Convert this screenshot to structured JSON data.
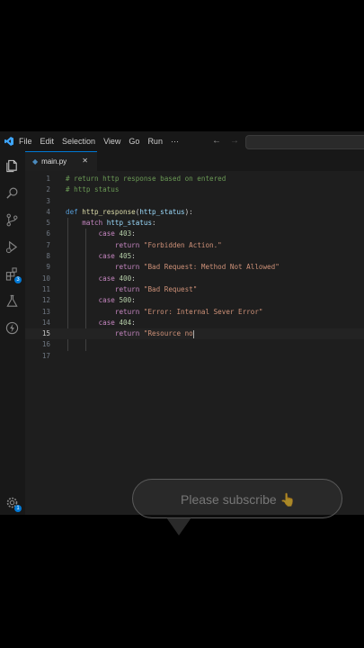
{
  "titlebar": {
    "menu": [
      "File",
      "Edit",
      "Selection",
      "View",
      "Go",
      "Run"
    ],
    "more": "···",
    "back_icon": "arrow-left-icon",
    "forward_icon": "arrow-right-icon"
  },
  "activitybar": {
    "icons": [
      "explorer-icon",
      "search-icon",
      "source-control-icon",
      "run-debug-icon",
      "extensions-icon",
      "testing-icon",
      "remote-icon"
    ],
    "extensions_badge": "3",
    "settings_badge": "1"
  },
  "tab": {
    "label": "main.py",
    "close": "✕"
  },
  "editor": {
    "line_numbers": [
      "1",
      "2",
      "3",
      "4",
      "5",
      "6",
      "7",
      "8",
      "9",
      "10",
      "11",
      "12",
      "13",
      "14",
      "15",
      "16",
      "17"
    ],
    "active_line": "15",
    "code": {
      "l1": "# return http response based on entered",
      "l2": "# http status",
      "l4_def": "def",
      "l4_func": "http_response",
      "l4_open": "(",
      "l4_param": "http_status",
      "l4_close": "):",
      "l5_kw": "match",
      "l5_var": "http_status",
      "l5_colon": ":",
      "case": "case",
      "ret": "return",
      "l6_num": "403",
      "l7_str": "\"Forbidden Action.\"",
      "l8_num": "405",
      "l9_str": "\"Bad Request: Method Not Allowed\"",
      "l10_num": "400",
      "l11_str": "\"Bad Request\"",
      "l12_num": "500",
      "l13_str": "\"Error: Internal Sever Error\"",
      "l14_num": "404",
      "l15_str": "\"Resource no",
      "colon": ":"
    }
  },
  "overlay": {
    "text": "Please subscribe 👆"
  }
}
